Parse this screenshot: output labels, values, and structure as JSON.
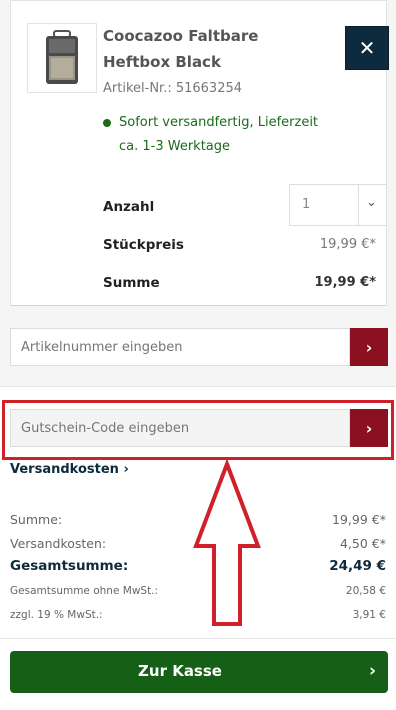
{
  "cart_item": {
    "product_name": "Coocazoo Faltbare Heftbox Black",
    "article_number": "Artikel-Nr.: 51663254",
    "availability": "Sofort versandfertig, Lieferzeit ca. 1-3 Werktage",
    "close_icon": "close-icon",
    "quantity_label": "Anzahl",
    "quantity_value": "1",
    "unit_price_label": "Stückpreis",
    "unit_price_value": "19,99 €*",
    "sum_label": "Summe",
    "sum_value": "19,99 €*"
  },
  "article_input": {
    "placeholder": "Artikelnummer eingeben"
  },
  "voucher_input": {
    "placeholder": "Gutschein-Code eingeben"
  },
  "shipping_link": "Versandkosten",
  "summary": {
    "sum_label": "Summe:",
    "sum_value": "19,99 €*",
    "shipping_label": "Versandkosten:",
    "shipping_value": "4,50 €*",
    "total_label": "Gesamtsumme:",
    "total_value": "24,49 €",
    "net_label": "Gesamtsumme ohne MwSt.:",
    "net_value": "20,58 €",
    "vat_label": "zzgl. 19 % MwSt.:",
    "vat_value": "3,91 €"
  },
  "checkout_label": "Zur Kasse",
  "colors": {
    "accent_red": "#8b1020",
    "checkout_green": "#165f16",
    "dark_blue": "#0d2a3e",
    "highlight_red": "#d0202a"
  }
}
